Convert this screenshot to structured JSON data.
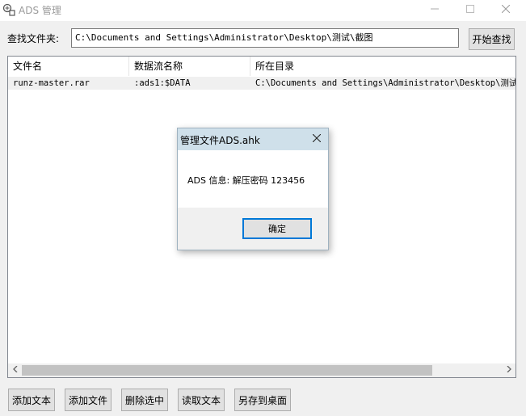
{
  "window": {
    "title": "ADS 管理",
    "icons": {
      "app": "app-icon",
      "minimize": "minimize-icon",
      "maximize": "maximize-icon",
      "close": "close-icon"
    }
  },
  "search": {
    "label": "查找文件夹:",
    "path_value": "C:\\Documents and Settings\\Administrator\\Desktop\\测试\\截图",
    "button_label": "开始查找"
  },
  "list": {
    "columns": [
      "文件名",
      "数据流名称",
      "所在目录"
    ],
    "rows": [
      [
        "runz-master.rar",
        ":ads1:$DATA",
        "C:\\Documents and Settings\\Administrator\\Desktop\\测试\\截图"
      ]
    ],
    "hscroll": {
      "left_arrow": "chevron-left-icon",
      "right_arrow": "chevron-right-icon"
    }
  },
  "actions": {
    "add_text": "添加文本",
    "add_file": "添加文件",
    "delete_selected": "删除选中",
    "read_text": "读取文本",
    "save_to_desktop": "另存到桌面"
  },
  "dialog": {
    "title": "管理文件ADS.ahk",
    "message": "ADS 信息: 解压密码 123456",
    "ok_label": "确定",
    "close_icon": "close-icon"
  },
  "colors": {
    "dialog_title_bg": "#cfe0ea",
    "default_button_border": "#0078d7",
    "selected_row_bg": "#f0f0f0"
  }
}
